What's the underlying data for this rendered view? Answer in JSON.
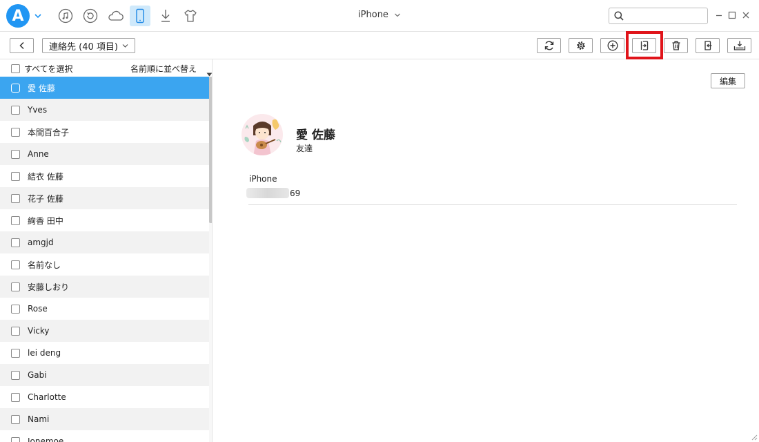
{
  "app": {
    "logo_letter": "A",
    "accent_color": "#2196f3",
    "nav_icons": [
      "music-icon",
      "restore-icon",
      "cloud-icon",
      "phone-icon",
      "download-icon",
      "shirt-icon"
    ],
    "device_name": "iPhone",
    "search_placeholder": ""
  },
  "toolbar": {
    "category_label": "連絡先 (40 項目)",
    "tools": [
      "refresh-icon",
      "settings-icon",
      "add-icon",
      "export-icon",
      "delete-icon",
      "import-icon",
      "save-to-computer-icon"
    ],
    "highlighted_tool": "export-icon",
    "highlight_color": "#e0141a"
  },
  "list": {
    "select_all_label": "すべてを選択",
    "sort_label": "名前順に並べ替える",
    "contacts": [
      {
        "name": "愛 佐藤"
      },
      {
        "name": "Yves"
      },
      {
        "name": "本間百合子"
      },
      {
        "name": "Anne"
      },
      {
        "name": "結衣 佐藤"
      },
      {
        "name": "花子 佐藤"
      },
      {
        "name": "絢香 田中"
      },
      {
        "name": "amgjd"
      },
      {
        "name": "名前なし"
      },
      {
        "name": "安藤しおり"
      },
      {
        "name": "Rose"
      },
      {
        "name": "Vicky"
      },
      {
        "name": "lei deng"
      },
      {
        "name": "Gabi"
      },
      {
        "name": "Charlotte"
      },
      {
        "name": "Nami"
      },
      {
        "name": "Jonemoe"
      }
    ],
    "selected_index": 0,
    "selected_color": "#3ba5f0"
  },
  "detail": {
    "edit_label": "編集",
    "name": "愛 佐藤",
    "group": "友達",
    "phone_label": "iPhone",
    "phone_suffix": "69"
  }
}
